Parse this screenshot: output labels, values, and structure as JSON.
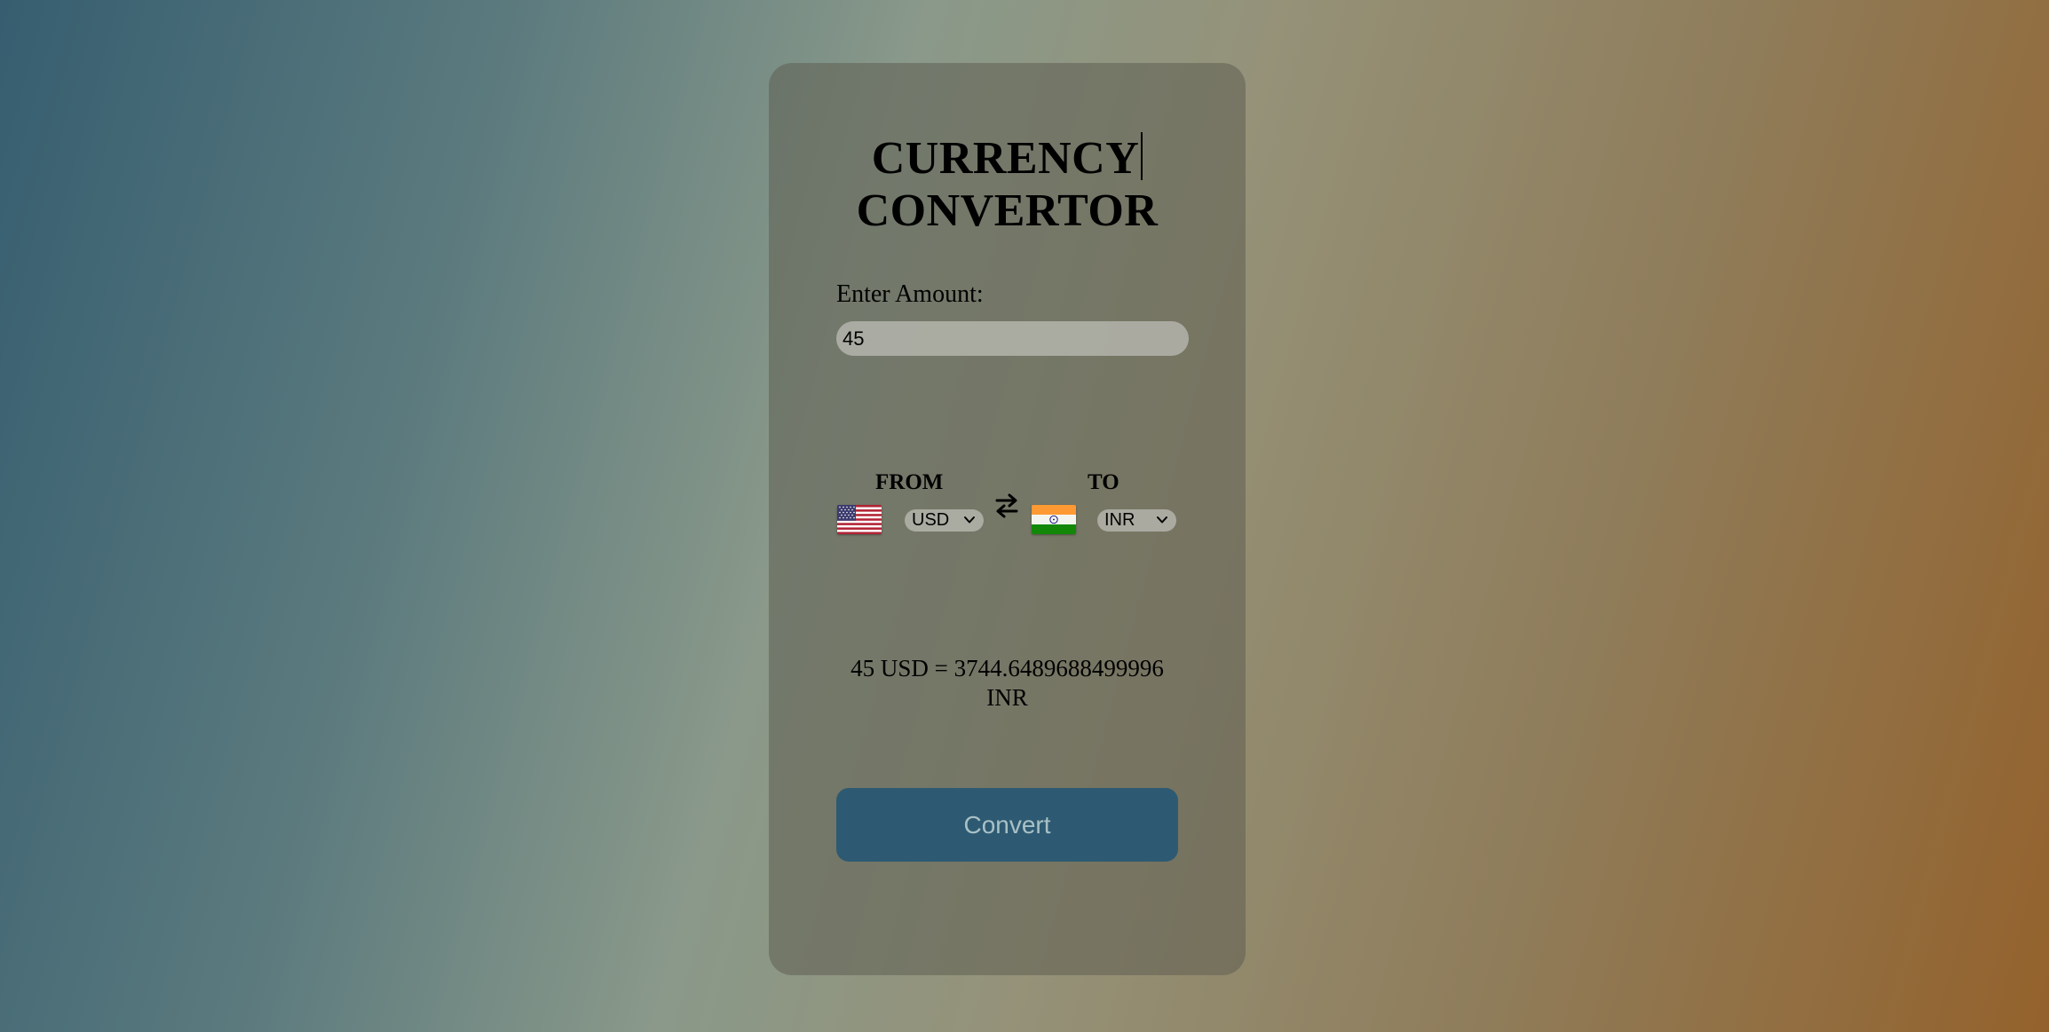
{
  "title": {
    "line1": "CURRENCY",
    "line2": "CONVERTOR"
  },
  "amount": {
    "label": "Enter Amount:",
    "value": "45"
  },
  "from": {
    "label": "FROM",
    "currency": "USD",
    "flag": "us-flag"
  },
  "to": {
    "label": "TO",
    "currency": "INR",
    "flag": "india-flag"
  },
  "swap_icon": "swap-arrows-icon",
  "result": {
    "text": "45 USD = 3744.6489688499996 INR"
  },
  "convert": {
    "label": "Convert"
  },
  "colors": {
    "button_bg": "#2d5a72",
    "button_text": "#a9c0c6"
  }
}
